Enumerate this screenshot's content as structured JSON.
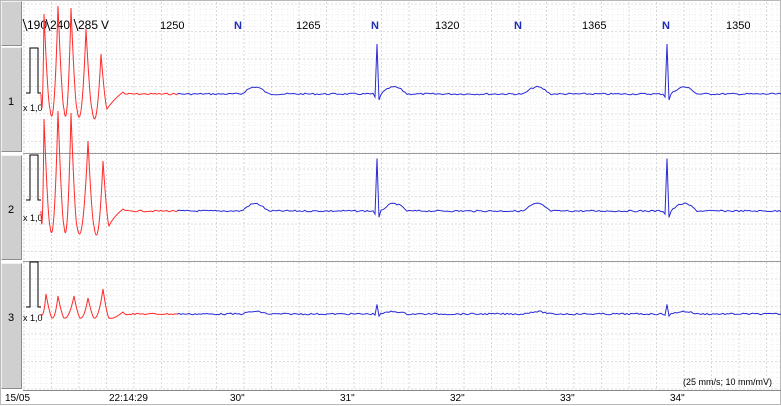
{
  "channels": [
    {
      "label": "1",
      "gain": "x 1,0"
    },
    {
      "label": "2",
      "gain": "x 1,0"
    },
    {
      "label": "3",
      "gain": "x 1,0"
    }
  ],
  "top_labels": {
    "pacing_values": [
      "190",
      "240",
      "285"
    ],
    "pacing_suffix": "V",
    "intervals": [
      "1250",
      "1265",
      "1320",
      "1365",
      "1350"
    ],
    "beat_marker": "N"
  },
  "time_axis": {
    "date": "15/05",
    "start_time": "22:14:29",
    "seconds": [
      "30\"",
      "31\"",
      "32\"",
      "33\"",
      "34\""
    ]
  },
  "speed_label": "(25 mm/s; 10 mm/mV)",
  "colors": {
    "stimulated_trace": "#ff2a2a",
    "normal_trace": "#2a2ad6",
    "grid_minor": "#dcdcdc",
    "grid_major": "#bdbdbd",
    "tab_background": "#cfcfcf"
  },
  "icons": [
    "calibration-pulse-icon"
  ]
}
